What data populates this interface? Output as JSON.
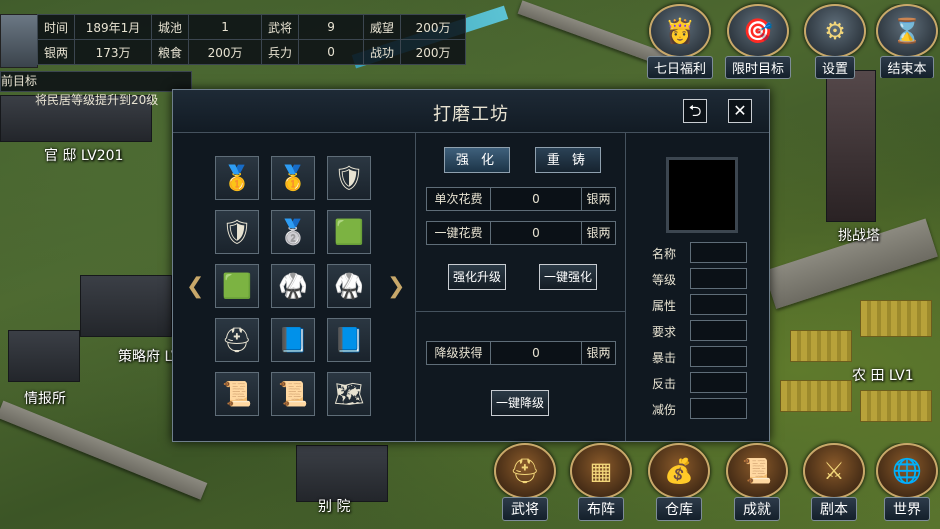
{
  "status": {
    "rows": [
      [
        {
          "k": "时间",
          "v": "189年1月"
        },
        {
          "k": "城池",
          "v": "1"
        },
        {
          "k": "武将",
          "v": "9"
        },
        {
          "k": "威望",
          "v": "200万"
        }
      ],
      [
        {
          "k": "银两",
          "v": "173万"
        },
        {
          "k": "粮食",
          "v": "200万"
        },
        {
          "k": "兵力",
          "v": "0"
        },
        {
          "k": "战功",
          "v": "200万"
        }
      ]
    ],
    "goal_label": "前目标",
    "goal_text": "将民居等级提升到20级"
  },
  "top_buttons": [
    {
      "label": "七日福利",
      "icon": "lady-portrait-icon"
    },
    {
      "label": "限时目标",
      "icon": "target-icon"
    },
    {
      "label": "设置",
      "icon": "gear-icon"
    },
    {
      "label": "结束本",
      "icon": "hourglass-icon"
    }
  ],
  "map_labels": {
    "official": "官 邸 LV201",
    "strategy": "策略府 LV",
    "intel": "情报所",
    "tower": "挑战塔",
    "farm": "农 田 LV1",
    "villa": "别 院"
  },
  "dialog": {
    "title": "打磨工坊",
    "tabs": {
      "strengthen": "强 化",
      "recast": "重 铸"
    },
    "rows": {
      "single_cost": {
        "label": "单次花费",
        "value": "0",
        "unit": "银两"
      },
      "one_key_cost": {
        "label": "一键花费",
        "value": "0",
        "unit": "银两"
      },
      "downgrade_gain": {
        "label": "降级获得",
        "value": "0",
        "unit": "银两"
      }
    },
    "buttons": {
      "upgrade": "强化升级",
      "one_key_strengthen": "一键强化",
      "one_key_downgrade": "一键降级"
    },
    "attributes": [
      "名称",
      "等级",
      "属性",
      "要求",
      "暴击",
      "反击",
      "减伤"
    ],
    "items": [
      {
        "icon": "gold-armor-icon",
        "glyph": "🥇"
      },
      {
        "icon": "gold-armor-icon",
        "glyph": "🥇"
      },
      {
        "icon": "gold-shield-icon",
        "glyph": "🛡"
      },
      {
        "icon": "gold-shield-icon",
        "glyph": "🛡"
      },
      {
        "icon": "silver-shield-icon",
        "glyph": "🥈"
      },
      {
        "icon": "green-armor-icon",
        "glyph": "🟩"
      },
      {
        "icon": "green-armor-icon",
        "glyph": "🟩"
      },
      {
        "icon": "silver-armor-icon",
        "glyph": "🥋"
      },
      {
        "icon": "silver-armor-icon",
        "glyph": "🥋"
      },
      {
        "icon": "helmet-icon",
        "glyph": "⛑"
      },
      {
        "icon": "blue-book-icon",
        "glyph": "📘"
      },
      {
        "icon": "blue-book-icon",
        "glyph": "📘"
      },
      {
        "icon": "scroll-icon",
        "glyph": "📜"
      },
      {
        "icon": "scroll-icon",
        "glyph": "📜"
      },
      {
        "icon": "map-scroll-icon",
        "glyph": "🗺"
      }
    ]
  },
  "bottom_buttons": [
    {
      "label": "武将",
      "icon": "helmet-icon"
    },
    {
      "label": "布阵",
      "icon": "formation-board-icon"
    },
    {
      "label": "仓库",
      "icon": "treasure-chest-icon"
    },
    {
      "label": "成就",
      "icon": "scroll-icon"
    },
    {
      "label": "剧本",
      "icon": "crossed-swords-icon"
    },
    {
      "label": "世界",
      "icon": "globe-icon"
    }
  ],
  "glyphs": {
    "return": "⮌",
    "close": "✕",
    "left_arrow": "❮",
    "right_arrow": "❯",
    "lady": "👸",
    "target": "🎯",
    "gear": "⚙",
    "hourglass": "⌛",
    "helmet": "⛑",
    "board": "▦",
    "chest": "💰",
    "scroll": "📜",
    "swords": "⚔",
    "globe": "🌐"
  }
}
